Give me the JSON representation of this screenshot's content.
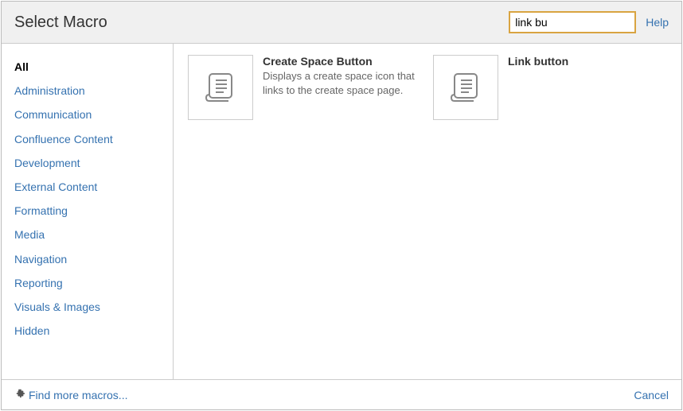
{
  "header": {
    "title": "Select Macro",
    "search_value": "link bu",
    "help_label": "Help"
  },
  "sidebar": {
    "items": [
      {
        "label": "All",
        "active": true
      },
      {
        "label": "Administration",
        "active": false
      },
      {
        "label": "Communication",
        "active": false
      },
      {
        "label": "Confluence Content",
        "active": false
      },
      {
        "label": "Development",
        "active": false
      },
      {
        "label": "External Content",
        "active": false
      },
      {
        "label": "Formatting",
        "active": false
      },
      {
        "label": "Media",
        "active": false
      },
      {
        "label": "Navigation",
        "active": false
      },
      {
        "label": "Reporting",
        "active": false
      },
      {
        "label": "Visuals & Images",
        "active": false
      },
      {
        "label": "Hidden",
        "active": false
      }
    ]
  },
  "macros": [
    {
      "title": "Create Space Button",
      "description": "Displays a create space icon that links to the create space page.",
      "icon": "scroll-icon"
    },
    {
      "title": "Link button",
      "description": "",
      "icon": "scroll-icon"
    }
  ],
  "footer": {
    "find_more_label": "Find more macros...",
    "cancel_label": "Cancel"
  }
}
